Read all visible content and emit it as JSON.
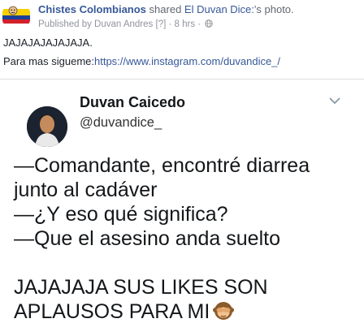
{
  "post": {
    "page_name": "Chistes Colombianos",
    "shared_text": "shared",
    "shared_source": "El Duvan Dice:",
    "shared_suffix": "'s photo.",
    "published_by": "Published by Duvan Andres",
    "published_marker": "[?]",
    "separator": "·",
    "time": "8 hrs",
    "time_separator": "·",
    "text_line1": "JAJAJAJAJAJAJA.",
    "text_line2_prefix": "Para mas sigueme:",
    "text_line2_url": "https://www.instagram.com/duvandice_/"
  },
  "tweet": {
    "name": "Duvan Caicedo",
    "handle": "@duvandice_",
    "lines": [
      "—Comandante, encontré diarrea",
      "junto al cadáver",
      "—¿Y eso qué significa?",
      "—Que el asesino anda suelto"
    ],
    "closing_line1": "JAJAJAJA SUS LIKES SON",
    "closing_line2": "APLAUSOS PARA MI"
  },
  "icons": {
    "page_avatar": "colombia-flag-avatar-icon",
    "globe": "globe-icon",
    "chevron": "chevron-down-icon",
    "emoji": "see-no-evil-monkey-icon"
  },
  "colors": {
    "link": "#365899",
    "muted": "#90949c",
    "text": "#1d2129"
  }
}
